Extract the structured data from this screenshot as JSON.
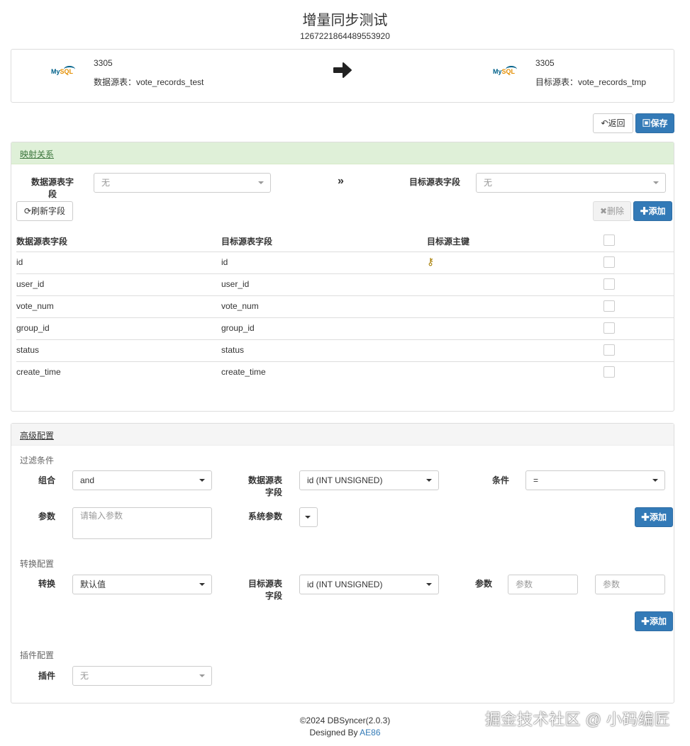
{
  "page": {
    "title": "增量同步测试",
    "subtitle": "1267221864489553920"
  },
  "connection": {
    "source": {
      "logo_my": "My",
      "logo_sql": "SQL",
      "port": "3305",
      "table_label": "数据源表：vote_records_test"
    },
    "target": {
      "logo_my": "My",
      "logo_sql": "SQL",
      "port": "3305",
      "table_label": "目标源表：vote_records_tmp"
    },
    "arrow_icon": "arrow-right-icon"
  },
  "actions": {
    "back_label": "返回",
    "save_label": "保存"
  },
  "mapping": {
    "heading": "映射关系",
    "source_field_label": "数据源表字\n段",
    "source_field_value": "无",
    "target_field_label": "目标源表字段",
    "target_field_value": "无",
    "refresh_label": "刷新字段",
    "delete_label": "删除",
    "add_label": "添加",
    "columns": [
      "数据源表字段",
      "目标源表字段",
      "目标源主键"
    ],
    "rows": [
      {
        "source": "id",
        "target": "id",
        "primary": true
      },
      {
        "source": "user_id",
        "target": "user_id",
        "primary": false
      },
      {
        "source": "vote_num",
        "target": "vote_num",
        "primary": false
      },
      {
        "source": "group_id",
        "target": "group_id",
        "primary": false
      },
      {
        "source": "status",
        "target": "status",
        "primary": false
      },
      {
        "source": "create_time",
        "target": "create_time",
        "primary": false
      }
    ]
  },
  "advanced": {
    "heading": "高级配置",
    "filter": {
      "section": "过滤条件",
      "group_label": "组合",
      "group_value": "and",
      "source_field_label": "数据源表\n字段",
      "source_field_value": "id (INT UNSIGNED)",
      "condition_label": "条件",
      "condition_value": "=",
      "param_label": "参数",
      "param_placeholder": "请输入参数",
      "system_param_label": "系统参数",
      "add_label": "添加"
    },
    "convert": {
      "section": "转换配置",
      "convert_label": "转换",
      "convert_value": "默认值",
      "target_field_label": "目标源表\n字段",
      "target_field_value": "id (INT UNSIGNED)",
      "param_label": "参数",
      "param1_placeholder": "参数",
      "param2_placeholder": "参数",
      "add_label": "添加"
    },
    "plugin": {
      "section": "插件配置",
      "plugin_label": "插件",
      "plugin_value": "无"
    }
  },
  "footer": {
    "copyright": "©2024 DBSyncer(2.0.3)",
    "designed_by": "Designed By ",
    "author": "AE86"
  },
  "overlay_watermark": "掘金技术社区 @ 小码编匠",
  "colors": {
    "primary": "#337ab7",
    "success_bg": "#dff0d8",
    "success_text": "#3c763d"
  }
}
